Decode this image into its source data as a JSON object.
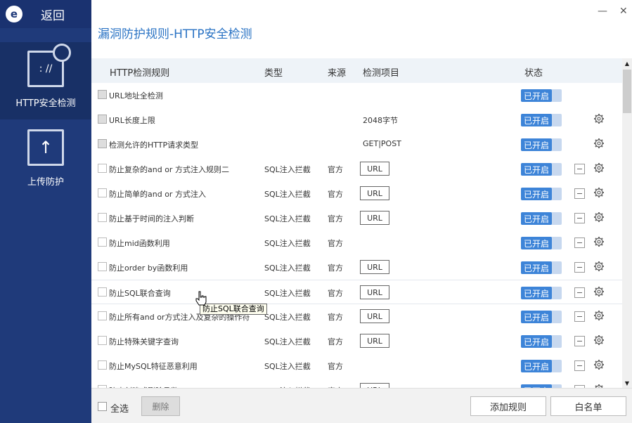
{
  "sidebar": {
    "logo_text": "e",
    "back_label": "返回",
    "items": [
      {
        "label": "HTTP安全检测",
        "icon": "http-shield-icon",
        "active": true,
        "glyph": ": //"
      },
      {
        "label": "上传防护",
        "icon": "upload-icon",
        "active": false,
        "glyph": "↑"
      }
    ]
  },
  "window": {
    "min_glyph": "—",
    "close_glyph": "✕"
  },
  "page_title": "漏洞防护规则-HTTP安全检测",
  "table": {
    "columns": {
      "rule": "HTTP检测规则",
      "type": "类型",
      "source": "来源",
      "item": "检测项目",
      "status": "状态"
    },
    "rows": [
      {
        "name": "URL地址全检测",
        "type": "",
        "source": "",
        "item": "",
        "url": false,
        "status": "已开启",
        "disabled": true,
        "minus": false,
        "gear": false
      },
      {
        "name": "URL长度上限",
        "type": "",
        "source": "",
        "item": "2048字节",
        "url": false,
        "status": "已开启",
        "disabled": true,
        "minus": false,
        "gear": true
      },
      {
        "name": "检测允许的HTTP请求类型",
        "type": "",
        "source": "",
        "item": "GET|POST",
        "url": false,
        "status": "已开启",
        "disabled": true,
        "minus": false,
        "gear": true
      },
      {
        "name": "防止复杂的and or 方式注入规则二",
        "type": "SQL注入拦截",
        "source": "官方",
        "item": "URL",
        "url": true,
        "status": "已开启",
        "disabled": false,
        "minus": true,
        "gear": true
      },
      {
        "name": "防止简单的and or 方式注入",
        "type": "SQL注入拦截",
        "source": "官方",
        "item": "URL",
        "url": true,
        "status": "已开启",
        "disabled": false,
        "minus": true,
        "gear": true
      },
      {
        "name": "防止基于时间的注入判断",
        "type": "SQL注入拦截",
        "source": "官方",
        "item": "URL",
        "url": true,
        "status": "已开启",
        "disabled": false,
        "minus": true,
        "gear": true
      },
      {
        "name": "防止mid函数利用",
        "type": "SQL注入拦截",
        "source": "官方",
        "item": "",
        "url": false,
        "status": "已开启",
        "disabled": false,
        "minus": true,
        "gear": true
      },
      {
        "name": "防止order by函数利用",
        "type": "SQL注入拦截",
        "source": "官方",
        "item": "URL",
        "url": true,
        "status": "已开启",
        "disabled": false,
        "minus": true,
        "gear": true
      },
      {
        "name": "防止SQL联合查询",
        "type": "SQL注入拦截",
        "source": "官方",
        "item": "URL",
        "url": true,
        "status": "已开启",
        "disabled": false,
        "minus": true,
        "gear": true,
        "hover": true
      },
      {
        "name": "防止所有and or方式注入及复杂的操作符",
        "type": "SQL注入拦截",
        "source": "官方",
        "item": "URL",
        "url": true,
        "status": "已开启",
        "disabled": false,
        "minus": true,
        "gear": true
      },
      {
        "name": "防止特殊关键字查询",
        "type": "SQL注入拦截",
        "source": "官方",
        "item": "URL",
        "url": true,
        "status": "已开启",
        "disabled": false,
        "minus": true,
        "gear": true
      },
      {
        "name": "防止MySQL特征恶意利用",
        "type": "SQL注入拦截",
        "source": "官方",
        "item": "",
        "url": false,
        "status": "已开启",
        "disabled": false,
        "minus": true,
        "gear": true
      },
      {
        "name": "防止创建或删除函数",
        "type": "SQL注入拦截",
        "source": "官方",
        "item": "URL",
        "url": true,
        "status": "已开启",
        "disabled": false,
        "minus": true,
        "gear": true
      }
    ]
  },
  "tooltip": "防止SQL联合查询",
  "footer": {
    "select_all": "全选",
    "delete": "删除",
    "add_rule": "添加规则",
    "whitelist": "白名单"
  },
  "colors": {
    "sidebar": "#1f3a7a",
    "accent": "#2a73c4",
    "toggle_on": "#3d84d8"
  }
}
